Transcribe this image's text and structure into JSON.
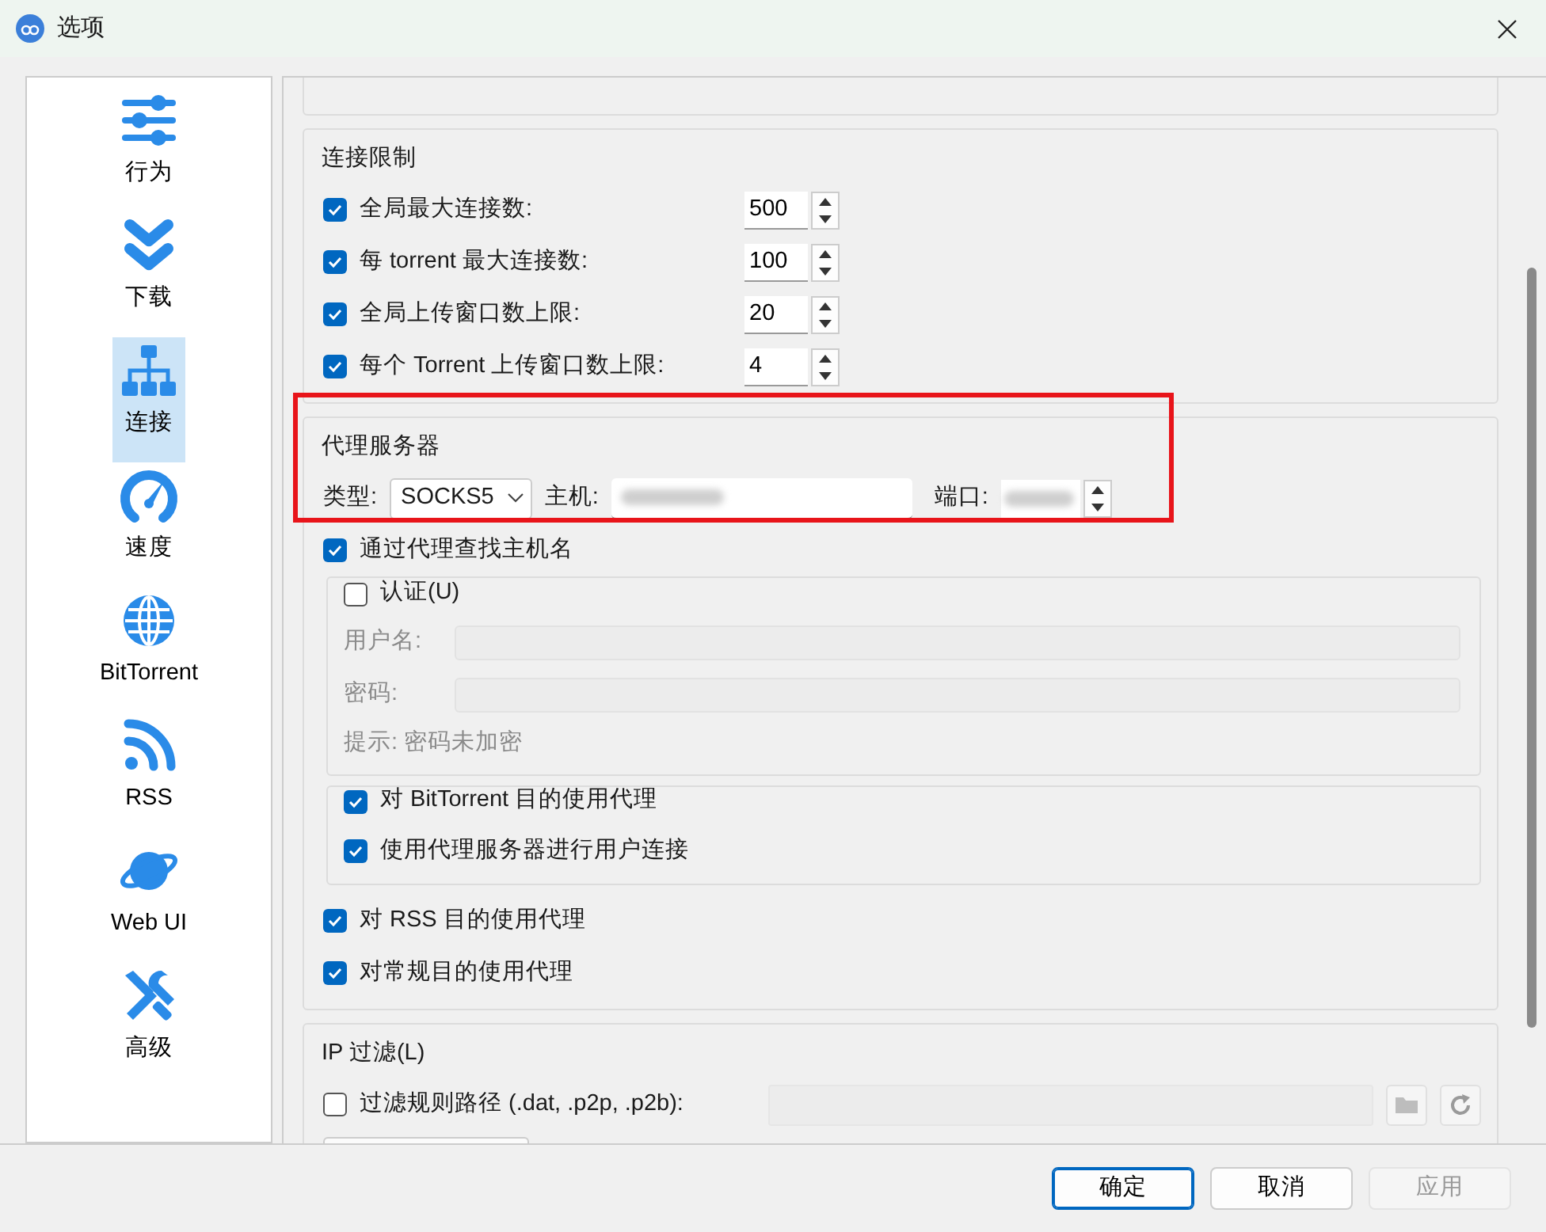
{
  "window": {
    "title": "选项"
  },
  "sidebar": {
    "items": [
      {
        "label": "行为",
        "selected": false
      },
      {
        "label": "下载",
        "selected": false
      },
      {
        "label": "连接",
        "selected": true
      },
      {
        "label": "速度",
        "selected": false
      },
      {
        "label": "BitTorrent",
        "selected": false
      },
      {
        "label": "RSS",
        "selected": false
      },
      {
        "label": "Web UI",
        "selected": false
      },
      {
        "label": "高级",
        "selected": false
      }
    ]
  },
  "connection_limits": {
    "title": "连接限制",
    "rows": [
      {
        "label": "全局最大连接数:",
        "checked": true,
        "value": "500"
      },
      {
        "label": "每 torrent 最大连接数:",
        "checked": true,
        "value": "100"
      },
      {
        "label": "全局上传窗口数上限:",
        "checked": true,
        "value": "20"
      },
      {
        "label": "每个 Torrent 上传窗口数上限:",
        "checked": true,
        "value": "4"
      }
    ]
  },
  "proxy": {
    "title": "代理服务器",
    "type_label": "类型:",
    "type_value": "SOCKS5",
    "host_label": "主机:",
    "port_label": "端口:",
    "lookup": {
      "label": "通过代理查找主机名",
      "checked": true
    },
    "auth": {
      "label": "认证(U)",
      "checked": false,
      "fields": [
        {
          "label": "用户名:"
        },
        {
          "label": "密码:"
        }
      ],
      "hint": "提示: 密码未加密"
    },
    "bittorrent": {
      "label": "对 BitTorrent 目的使用代理",
      "checked": true,
      "sub": {
        "label": "使用代理服务器进行用户连接",
        "checked": true
      }
    },
    "rss": {
      "label": "对 RSS 目的使用代理",
      "checked": true
    },
    "general": {
      "label": "对常规目的使用代理",
      "checked": true
    }
  },
  "ip_filter": {
    "title": "IP 过滤(L)",
    "path": {
      "label": "过滤规则路径 (.dat, .p2p, .p2b):",
      "checked": false
    }
  },
  "buttons": [
    {
      "label": "确定",
      "disabled": false,
      "default": true
    },
    {
      "label": "取消",
      "disabled": false,
      "default": false
    },
    {
      "label": "应用",
      "disabled": true,
      "default": false
    }
  ]
}
